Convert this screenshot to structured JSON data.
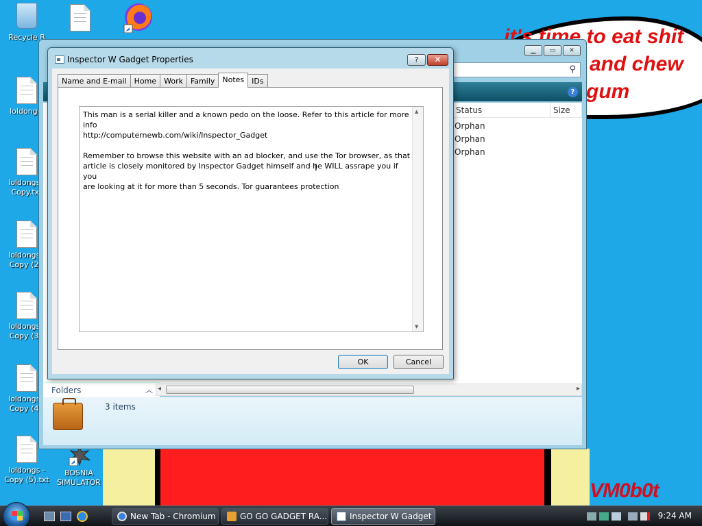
{
  "wallpaper": {
    "bubble_line1": "it's time to eat shit",
    "bubble_line2": "and chew",
    "bubble_line3": "gum",
    "signature": "VM0b0t"
  },
  "desktop_icons": [
    {
      "label": "Recycle B",
      "icon": "recycle-bin-icon"
    },
    {
      "label": "loldongs.",
      "icon": "text-file-icon"
    },
    {
      "label": "loldongs - Copy.txt",
      "icon": "text-file-icon"
    },
    {
      "label": "loldongs - Copy (2).",
      "icon": "text-file-icon"
    },
    {
      "label": "loldongs - Copy (3).",
      "icon": "text-file-icon"
    },
    {
      "label": "loldongs - Copy (4).",
      "icon": "text-file-icon"
    },
    {
      "label": "loldongs - Copy (5).txt",
      "icon": "text-file-icon"
    },
    {
      "label": "BOSNIA SIMULATOR",
      "icon": "shortcut-icon"
    }
  ],
  "explorer": {
    "columns": [
      "Status",
      "Size"
    ],
    "rows": [
      {
        "status": "Orphan"
      },
      {
        "status": "Orphan"
      },
      {
        "status": "Orphan"
      }
    ],
    "folders_label": "Folders",
    "items_count": "3 items"
  },
  "dialog": {
    "title": "Inspector W Gadget Properties",
    "help_label": "?",
    "close_label": "✕",
    "tabs": [
      {
        "label": "Name and E-mail"
      },
      {
        "label": "Home"
      },
      {
        "label": "Work"
      },
      {
        "label": "Family"
      },
      {
        "label": "Notes",
        "active": true
      },
      {
        "label": "IDs"
      }
    ],
    "notes_paragraph1_line1": "This man is a serial killer and a known pedo on the loose. Refer to this article for more info",
    "notes_paragraph1_line2": "http://computernewb.com/wiki/Inspector_Gadget",
    "notes_paragraph2_line1": "Remember to browse this website with an ad blocker, and use the Tor browser, as that",
    "notes_paragraph2_line2": "article is closely monitored by Inspector Gadget himself and he WILL assrape you if you",
    "notes_paragraph2_line3": "are looking at it for more than 5 seconds. Tor guarantees protection",
    "ok_label": "OK",
    "cancel_label": "Cancel"
  },
  "taskbar": {
    "tasks": [
      {
        "label": "New Tab - Chromium",
        "icon_color": "#3b7fe0"
      },
      {
        "label": "GO GO GADGET RA...",
        "icon_color": "#e8a030"
      },
      {
        "label": "Inspector W Gadget ...",
        "icon_color": "#4a7aa0",
        "active": true
      }
    ],
    "clock": "9:24 AM"
  }
}
